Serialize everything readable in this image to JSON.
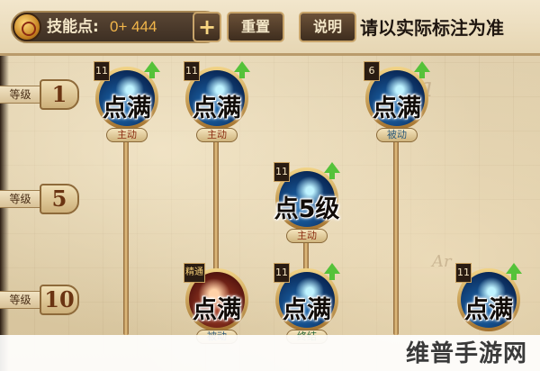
{
  "header": {
    "skill_points_label": "技能点:",
    "skill_points_value": "0+ 444",
    "add_label": "+",
    "reset_label": "重置",
    "help_label": "说明",
    "note": "请以实际标注为准",
    "coin_icon": "skill-point-coin-icon"
  },
  "levels": [
    {
      "label": "等级",
      "value": "1"
    },
    {
      "label": "等级",
      "value": "5"
    },
    {
      "label": "等级",
      "value": "10"
    }
  ],
  "skills": [
    {
      "level": "11",
      "text": "点满",
      "type": "主动",
      "upgradable": true
    },
    {
      "level": "11",
      "text": "点满",
      "type": "主动",
      "upgradable": true
    },
    {
      "level": "6",
      "text": "点满",
      "type": "被动",
      "upgradable": true
    },
    {
      "level": "11",
      "text": "点5级",
      "type": "主动",
      "upgradable": true
    },
    {
      "level": "精通",
      "text": "点满",
      "type": "被动",
      "upgradable": false
    },
    {
      "level": "11",
      "text": "点满",
      "type": "终结",
      "upgradable": true
    },
    {
      "level": "11",
      "text": "点满",
      "type": "",
      "upgradable": true
    }
  ],
  "watermark": "维普手游网",
  "colors": {
    "parchment": "#d9c7a1",
    "bar_dark": "#3e2d1e",
    "gold_border": "#c8a46a",
    "upgrade_arrow": "#55c23a",
    "skill_blue": "#1d6fb8",
    "skill_fire": "#b84a2c"
  }
}
